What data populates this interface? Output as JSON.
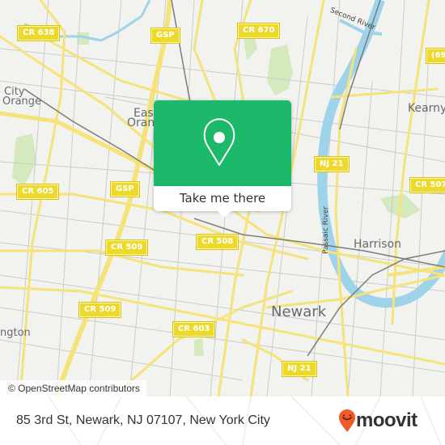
{
  "map": {
    "colors": {
      "background": "#f2f2ef",
      "road_major": "#f5e37a",
      "road_minor": "#c8c8c8",
      "water": "#9ed3ea",
      "park": "#cfe7b4",
      "rail": "#7c7c7c",
      "shield": "#ecd92b"
    },
    "place_labels": [
      {
        "id": "city-orange",
        "text": "City"
      },
      {
        "id": "city-orange-2",
        "text": "Orange"
      },
      {
        "id": "east-orange",
        "text": "East"
      },
      {
        "id": "east-orange-2",
        "text": "Orange"
      },
      {
        "id": "kearny",
        "text": "Kearny"
      },
      {
        "id": "harrison",
        "text": "Harrison"
      },
      {
        "id": "newark",
        "text": "Newark"
      },
      {
        "id": "irvington",
        "text": "ngton"
      }
    ],
    "river_labels": [
      {
        "id": "second-river",
        "text": "Second River"
      },
      {
        "id": "passaic-river",
        "text": "Passaic River"
      }
    ],
    "route_shields": [
      {
        "id": "cr638",
        "text": "CR 638"
      },
      {
        "id": "gsp-north",
        "text": "GSP"
      },
      {
        "id": "cr670",
        "text": "CR 670"
      },
      {
        "id": "r69x",
        "text": "(69"
      },
      {
        "id": "nj21-north",
        "text": "NJ 21"
      },
      {
        "id": "cr605",
        "text": "CR 605"
      },
      {
        "id": "gsp-south",
        "text": "GSP"
      },
      {
        "id": "cr507",
        "text": "CR 507"
      },
      {
        "id": "cr508",
        "text": "CR 508"
      },
      {
        "id": "cr509-north",
        "text": "CR 509"
      },
      {
        "id": "cr509-south",
        "text": "CR 509"
      },
      {
        "id": "cr603",
        "text": "CR 603"
      },
      {
        "id": "nj21-south",
        "text": "NJ 21"
      }
    ],
    "attribution": "© OpenStreetMap contributors"
  },
  "popup": {
    "icon": "map-pin-icon",
    "button_label": "Take me there",
    "color": "#1db96a"
  },
  "footer": {
    "address": "85 3rd St, Newark, NJ 07107, New York City",
    "logo": {
      "text": "moovit",
      "icon": "moovit-pin-icon",
      "icon_color": "#f05a28"
    }
  }
}
